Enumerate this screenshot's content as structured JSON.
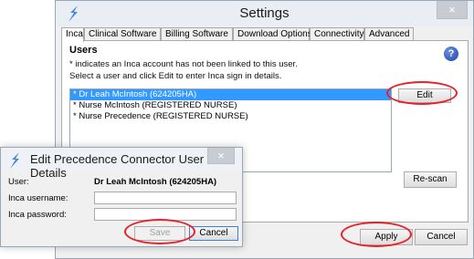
{
  "settings": {
    "title": "Settings",
    "close_label": "×",
    "tabs": [
      {
        "label": "Inca"
      },
      {
        "label": "Clinical Software"
      },
      {
        "label": "Billing Software"
      },
      {
        "label": "Download Options"
      },
      {
        "label": "Connectivity"
      },
      {
        "label": "Advanced"
      }
    ],
    "active_tab": "Inca",
    "users_heading": "Users",
    "info_line1": "* indicates an Inca account has not been linked to this user.",
    "info_line2": "Select a user and click Edit to enter Inca sign in details.",
    "help_label": "?",
    "users": [
      {
        "label": "* Dr Leah McIntosh (624205HA)",
        "selected": true
      },
      {
        "label": "* Nurse McIntosh (REGISTERED NURSE)",
        "selected": false
      },
      {
        "label": "* Nurse Precedence (REGISTERED NURSE)",
        "selected": false
      }
    ],
    "edit_label": "Edit",
    "rescan_label": "Re-scan",
    "apply_label": "Apply",
    "cancel_label": "Cancel"
  },
  "dialog": {
    "title": "Edit Precedence Connector User Details",
    "close_label": "×",
    "user_label": "User:",
    "user_value": "Dr Leah McIntosh (624205HA)",
    "username_label": "Inca username:",
    "username_value": "",
    "password_label": "Inca password:",
    "password_value": "",
    "save_label": "Save",
    "cancel_label": "Cancel"
  },
  "colors": {
    "selection": "#3399ff",
    "highlight_ring": "#e8202a",
    "help_icon": "#1d44b0"
  }
}
